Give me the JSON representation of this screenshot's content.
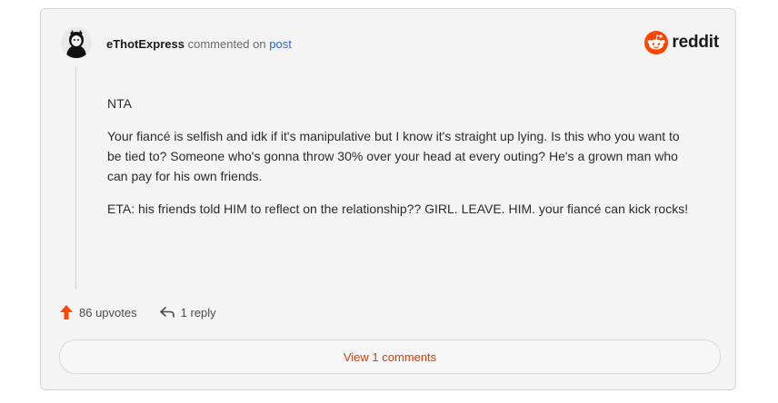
{
  "header": {
    "username": "eThotExpress",
    "commented_text": "commented on",
    "post_link": "post",
    "brand": "reddit"
  },
  "comment": {
    "paragraphs": [
      "NTA",
      "Your fiancé is selfish and idk if it's manipulative but I know it's straight up lying. Is this who you want to be tied to? Someone who's gonna throw 30% over your head at every outing? He's a grown man who can pay for his own friends.",
      "ETA: his friends told HIM to reflect on the relationship?? GIRL. LEAVE. HIM. your fiancé can kick rocks!"
    ]
  },
  "actions": {
    "upvotes": "86 upvotes",
    "replies": "1 reply"
  },
  "view_comments_label": "View 1 comments",
  "colors": {
    "accent": "#d93a00",
    "reddit_orange": "#ff4500",
    "upvote": "#ff4500",
    "link": "#3366cc"
  },
  "icons": {
    "avatar": "avatar-icon",
    "brand": "reddit-logo-icon",
    "upvote": "upvote-arrow-icon",
    "reply": "reply-arrow-icon"
  }
}
